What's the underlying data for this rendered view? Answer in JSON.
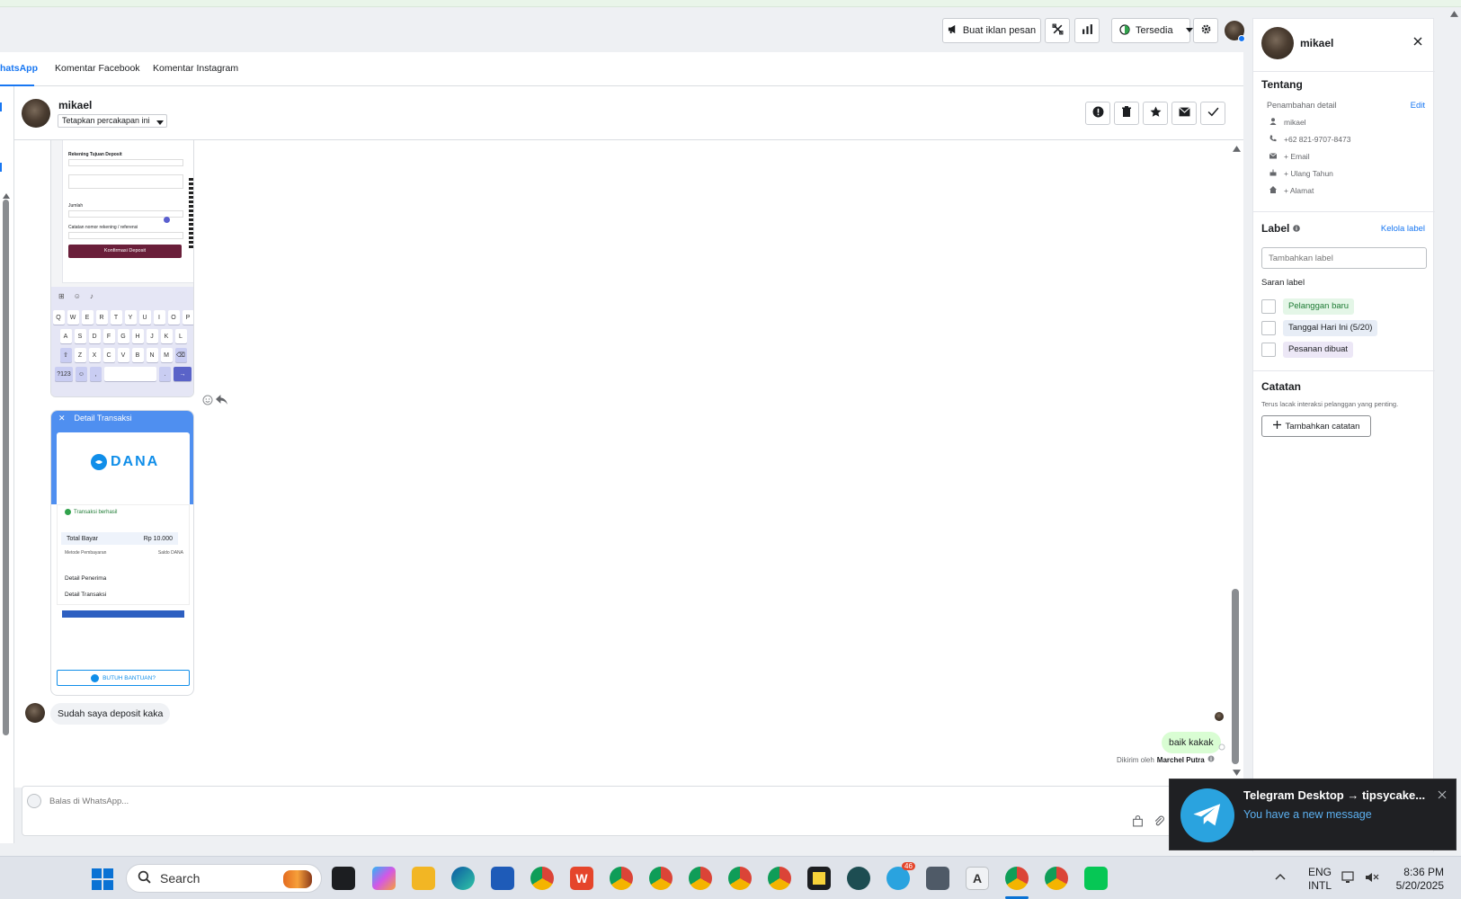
{
  "toolbar": {
    "boost_label": "Buat iklan pesan",
    "status_label": "Tersedia"
  },
  "tabs": [
    {
      "label": "hatsApp"
    },
    {
      "label": "Komentar Facebook"
    },
    {
      "label": "Komentar Instagram"
    }
  ],
  "conversation": {
    "contact_name": "mikael",
    "assign_label": "Tetapkan percakapan ini"
  },
  "receipt": {
    "header": "Detail Transaksi",
    "brand": "DANA",
    "status": "Transaksi berhasil",
    "total_label": "Total Bayar",
    "total_value": "Rp 10.000",
    "recipient_label": "Detail Penerima",
    "transaction_label": "Detail Transaksi",
    "help_label": "BUTUH BANTUAN?",
    "payment_method_label": "Metode Pembayaran",
    "payment_method_value": "Saldo DANA"
  },
  "deposit_form": {
    "account_label": "Rekening Tujuan Deposit",
    "amount_label": "Jumlah",
    "note_label": "Catatan nomor rekening / referensi",
    "confirm_label": "Konfirmasi Deposit"
  },
  "keyboard": {
    "row1": [
      "Q",
      "W",
      "E",
      "R",
      "T",
      "Y",
      "U",
      "I",
      "O",
      "P"
    ],
    "row2": [
      "A",
      "S",
      "D",
      "F",
      "G",
      "H",
      "J",
      "K",
      "L"
    ],
    "row3": [
      "Z",
      "X",
      "C",
      "V",
      "B",
      "N",
      "M"
    ],
    "num_key": "?123"
  },
  "messages": {
    "incoming_text": "Sudah saya deposit kaka",
    "outgoing_text": "baik kakak",
    "sent_by_prefix": "Dikirim oleh",
    "sent_by_name": "Marchel Putra"
  },
  "composer": {
    "placeholder": "Balas di WhatsApp..."
  },
  "right_panel": {
    "name": "mikael",
    "about_title": "Tentang",
    "details_label": "Penambahan detail",
    "edit_label": "Edit",
    "details": [
      {
        "icon": "person-icon",
        "text": "mikael"
      },
      {
        "icon": "phone-icon",
        "text": "+62 821-9707-8473"
      },
      {
        "icon": "mail-icon",
        "text": "+ Email"
      },
      {
        "icon": "cake-icon",
        "text": "+ Ulang Tahun"
      },
      {
        "icon": "home-icon",
        "text": "+ Alamat"
      }
    ],
    "label_title": "Label",
    "manage_label": "Kelola label",
    "label_placeholder": "Tambahkan label",
    "suggest_title": "Saran label",
    "suggestions": [
      {
        "text": "Pelanggan baru",
        "bg": "#e4f6e7",
        "fg": "#1e7b34"
      },
      {
        "text": "Tanggal Hari Ini (5/20)",
        "bg": "#e7edf6",
        "fg": "#1c1e21"
      },
      {
        "text": "Pesanan dibuat",
        "bg": "#ece7f6",
        "fg": "#1c1e21"
      }
    ],
    "notes_title": "Catatan",
    "notes_desc": "Terus lacak interaksi pelanggan yang penting.",
    "add_note_label": "Tambahkan catatan"
  },
  "toast": {
    "title": "Telegram Desktop → tipsycake...",
    "message": "You have a new message"
  },
  "taskbar": {
    "search_label": "Search",
    "lang_top": "ENG",
    "lang_bottom": "INTL",
    "time": "8:36 PM",
    "date": "5/20/2025",
    "telegram_badge": "46"
  },
  "colors": {
    "accent": "#1877f2",
    "dana_blue": "#108ee9",
    "outgoing_bubble": "#d9fdd3",
    "telegram": "#2aa3df"
  }
}
